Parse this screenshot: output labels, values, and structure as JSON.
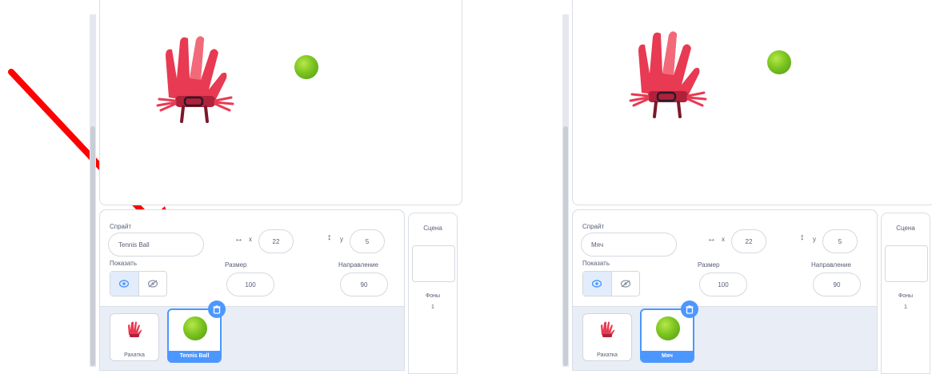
{
  "colors": {
    "arrow": "#ff0000",
    "accent": "#4c97ff",
    "glove": "#e83a52",
    "ball": "#7cc420"
  },
  "panels": [
    {
      "sprite_label": "Спрайт",
      "sprite_name": "Tennis Ball",
      "x_label": "x",
      "x_value": "22",
      "y_label": "y",
      "y_value": "5",
      "show_label": "Показать",
      "size_label": "Размер",
      "size_value": "100",
      "direction_label": "Направление",
      "direction_value": "90",
      "sprites": [
        {
          "name": "Рахатка"
        },
        {
          "name": "Tennis Ball"
        }
      ],
      "scene_label": "Сцена",
      "backdrops_label": "Фоны",
      "backdrops_count": "1"
    },
    {
      "sprite_label": "Спрайт",
      "sprite_name": "Мяч",
      "x_label": "x",
      "x_value": "22",
      "y_label": "y",
      "y_value": "5",
      "show_label": "Показать",
      "size_label": "Размер",
      "size_value": "100",
      "direction_label": "Направление",
      "direction_value": "90",
      "sprites": [
        {
          "name": "Рахатка"
        },
        {
          "name": "Мяч"
        }
      ],
      "scene_label": "Сцена",
      "backdrops_label": "Фоны",
      "backdrops_count": "1"
    }
  ],
  "icons": {
    "arrow": "red-arrow-pointer",
    "eye": "eye-icon",
    "eye_off": "eye-off-icon",
    "trash": "trash-icon",
    "glove": "glove-sprite",
    "ball": "tennis-ball-sprite"
  }
}
